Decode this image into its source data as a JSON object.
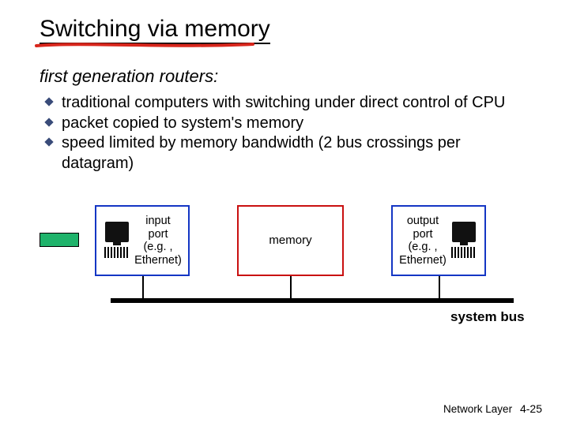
{
  "title": "Switching via memory",
  "subhead": "first generation routers:",
  "bullets": [
    "traditional computers with switching under direct control of CPU",
    "packet copied to system's memory",
    " speed limited by memory bandwidth (2 bus crossings per datagram)"
  ],
  "diagram": {
    "input_label": "input\nport\n(e.g. ,\nEthernet)",
    "memory_label": "memory",
    "output_label": "output\nport\n(e.g. ,\nEthernet)",
    "bus_label": "system bus"
  },
  "footer": {
    "chapter": "Network Layer",
    "page": "4-25"
  }
}
